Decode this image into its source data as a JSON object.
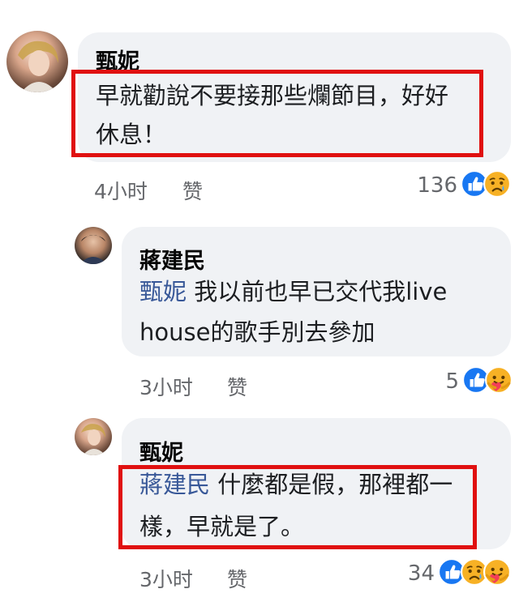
{
  "comments": [
    {
      "author": "甄妮",
      "mention": "",
      "lines": [
        "早就勸說不要接那些爛節目，好好",
        "休息！"
      ],
      "time": "4小时",
      "like_label": "赞",
      "reaction_count": "136",
      "reactions": [
        "like-icon",
        "sad-icon"
      ]
    },
    {
      "author": "蔣建民",
      "mention": "甄妮",
      "lines": [
        " 我以前也早已交代我live",
        "house的歌手別去參加"
      ],
      "time": "3小时",
      "like_label": "赞",
      "reaction_count": "5",
      "reactions": [
        "like-icon",
        "care-icon"
      ]
    },
    {
      "author": "甄妮",
      "mention": "蔣建民",
      "lines": [
        " 什麼都是假，那裡都一",
        "樣，早就是了。"
      ],
      "time": "3小时",
      "like_label": "赞",
      "reaction_count": "34",
      "reactions": [
        "like-icon",
        "sad-icon",
        "care-icon"
      ]
    }
  ],
  "colors": {
    "bubble": "#f0f2f5",
    "highlight_box": "#e01010",
    "mention": "#385898",
    "meta_text": "#65676b",
    "like_blue": "#1877f2",
    "emoji_yellow": "#f7b125"
  }
}
